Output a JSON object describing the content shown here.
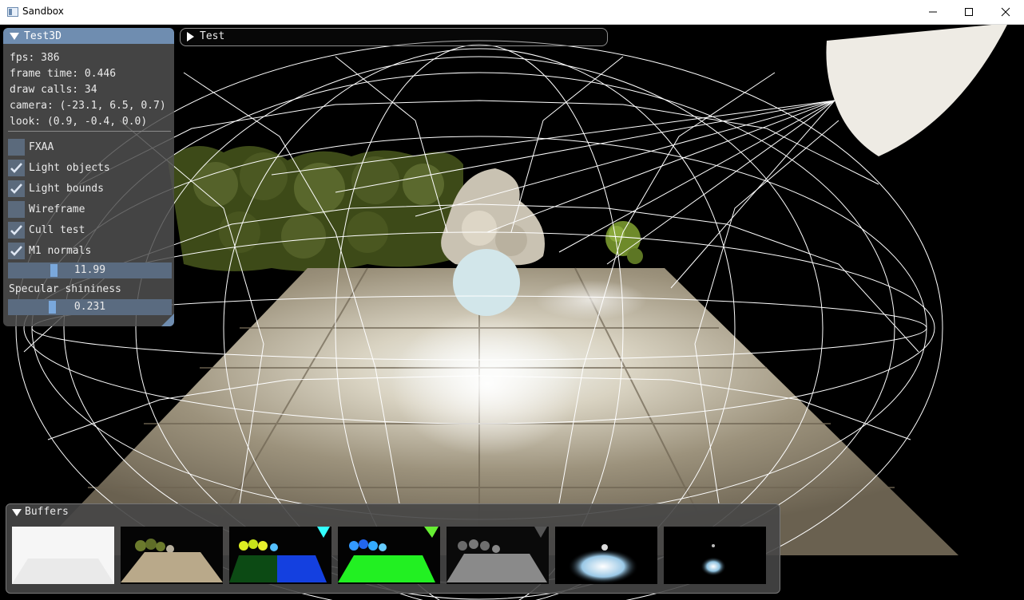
{
  "window": {
    "title": "Sandbox"
  },
  "test3d": {
    "title": "Test3D",
    "stats": [
      "fps: 386",
      "frame time: 0.446",
      "draw calls: 34",
      "camera: (-23.1, 6.5, 0.7)",
      "look: (0.9, -0.4, 0.0)"
    ],
    "options": [
      {
        "label": "FXAA",
        "checked": false
      },
      {
        "label": "Light objects",
        "checked": true
      },
      {
        "label": "Light bounds",
        "checked": true
      },
      {
        "label": "Wireframe",
        "checked": false
      },
      {
        "label": "Cull test",
        "checked": true
      },
      {
        "label": "M1 normals",
        "checked": true
      }
    ],
    "slider1": {
      "value": "11.99",
      "fraction": 0.25
    },
    "specular_label": "Specular shininess",
    "slider2": {
      "value": "0.231",
      "fraction": 0.23
    }
  },
  "test_panel": {
    "title": "Test"
  },
  "buffers": {
    "title": "Buffers",
    "thumbnails": [
      "buffer-depth",
      "buffer-albedo",
      "buffer-normals",
      "buffer-normals-green",
      "buffer-specular",
      "buffer-lighting",
      "buffer-lighting-dim"
    ]
  },
  "colors": {
    "accent": "#6f8db0",
    "checkbox": "#5b6a7c",
    "check": "#e0e8f4",
    "slider_grab": "#7aa8dc"
  }
}
